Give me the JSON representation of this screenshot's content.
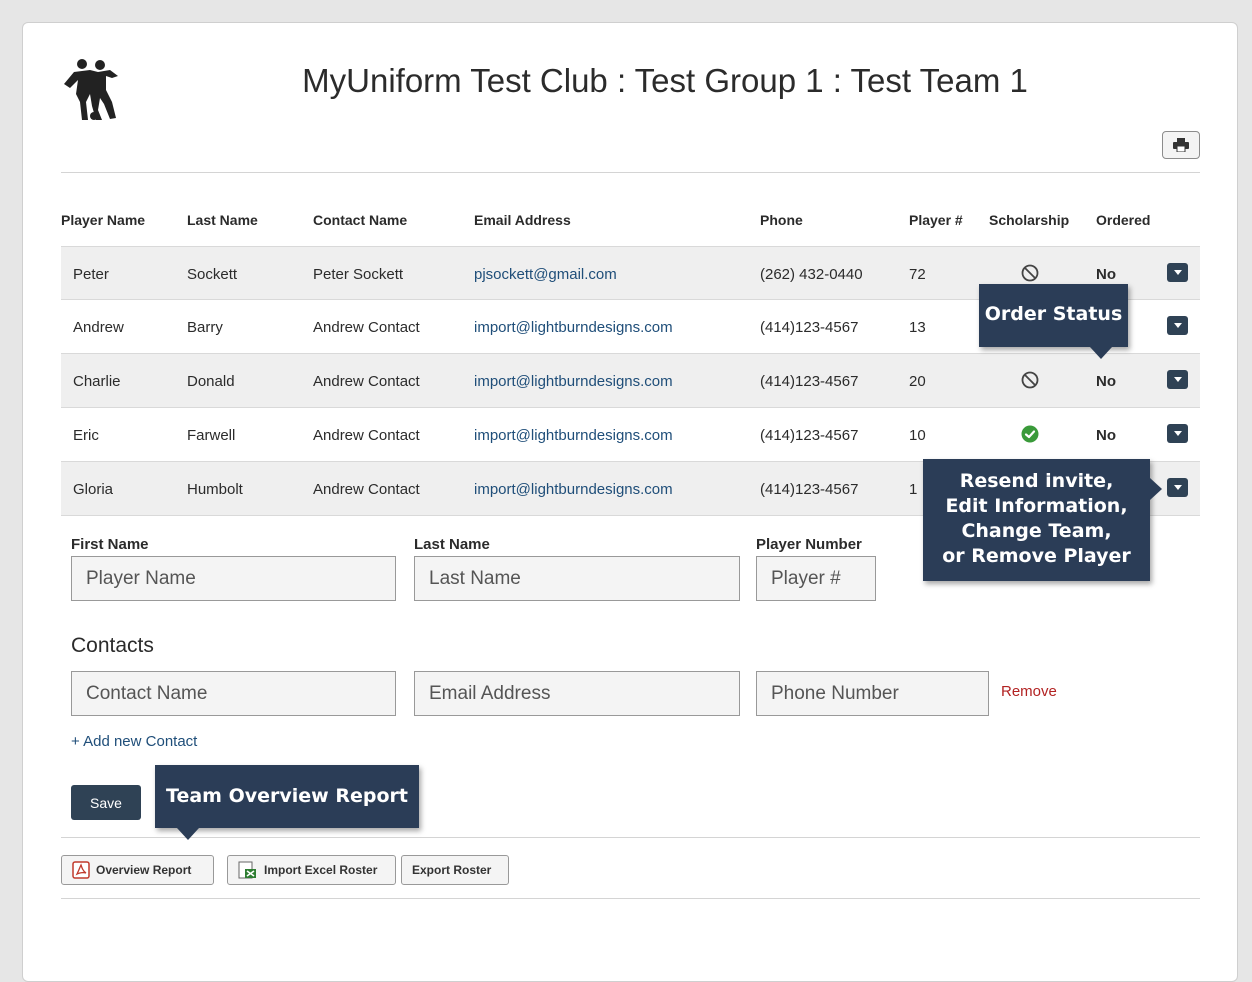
{
  "header": {
    "title": "MyUniform Test Club : Test Group 1 : Test Team 1",
    "logo_icon": "soccer-players-icon",
    "print_icon": "printer-icon"
  },
  "table": {
    "columns": [
      "Player Name",
      "Last Name",
      "Contact Name",
      "Email Address",
      "Phone",
      "Player #",
      "Scholarship",
      "Ordered"
    ],
    "rows": [
      {
        "first": "Peter",
        "last": "Sockett",
        "contact": "Peter Sockett",
        "email": "pjsockett@gmail.com",
        "phone": "(262) 432-0440",
        "number": "72",
        "scholarship": "no",
        "ordered": "No"
      },
      {
        "first": "Andrew",
        "last": "Barry",
        "contact": "Andrew Contact",
        "email": "import@lightburndesigns.com",
        "phone": "(414)123-4567",
        "number": "13",
        "scholarship": "",
        "ordered": ""
      },
      {
        "first": "Charlie",
        "last": "Donald",
        "contact": "Andrew Contact",
        "email": "import@lightburndesigns.com",
        "phone": "(414)123-4567",
        "number": "20",
        "scholarship": "no",
        "ordered": "No"
      },
      {
        "first": "Eric",
        "last": "Farwell",
        "contact": "Andrew Contact",
        "email": "import@lightburndesigns.com",
        "phone": "(414)123-4567",
        "number": "10",
        "scholarship": "yes",
        "ordered": "No"
      },
      {
        "first": "Gloria",
        "last": "Humbolt",
        "contact": "Andrew Contact",
        "email": "import@lightburndesigns.com",
        "phone": "(414)123-4567",
        "number": "1",
        "scholarship": "",
        "ordered": ""
      }
    ]
  },
  "form": {
    "first_name_label": "First Name",
    "first_name_placeholder": "Player Name",
    "last_name_label": "Last Name",
    "last_name_placeholder": "Last Name",
    "player_number_label": "Player Number",
    "player_number_placeholder": "Player #",
    "contacts_heading": "Contacts",
    "contact_name_placeholder": "Contact Name",
    "email_placeholder": "Email Address",
    "phone_placeholder": "Phone Number",
    "remove_label": "Remove",
    "add_contact_label": "+ Add new Contact",
    "save_label": "Save"
  },
  "bottom_buttons": {
    "overview_report": "Overview Report",
    "import_excel": "Import Excel Roster",
    "export_roster": "Export Roster"
  },
  "callouts": {
    "order_status": "Order Status",
    "player_actions": [
      "Resend invite,",
      "Edit Information,",
      "Change Team,",
      "or Remove Player"
    ],
    "team_overview": "Team Overview Report"
  },
  "colors": {
    "accent_dark": "#2f4255",
    "callout_bg": "#2b3d57",
    "link": "#1f4e79",
    "remove": "#b22222",
    "check_green": "#3a9a3a"
  }
}
